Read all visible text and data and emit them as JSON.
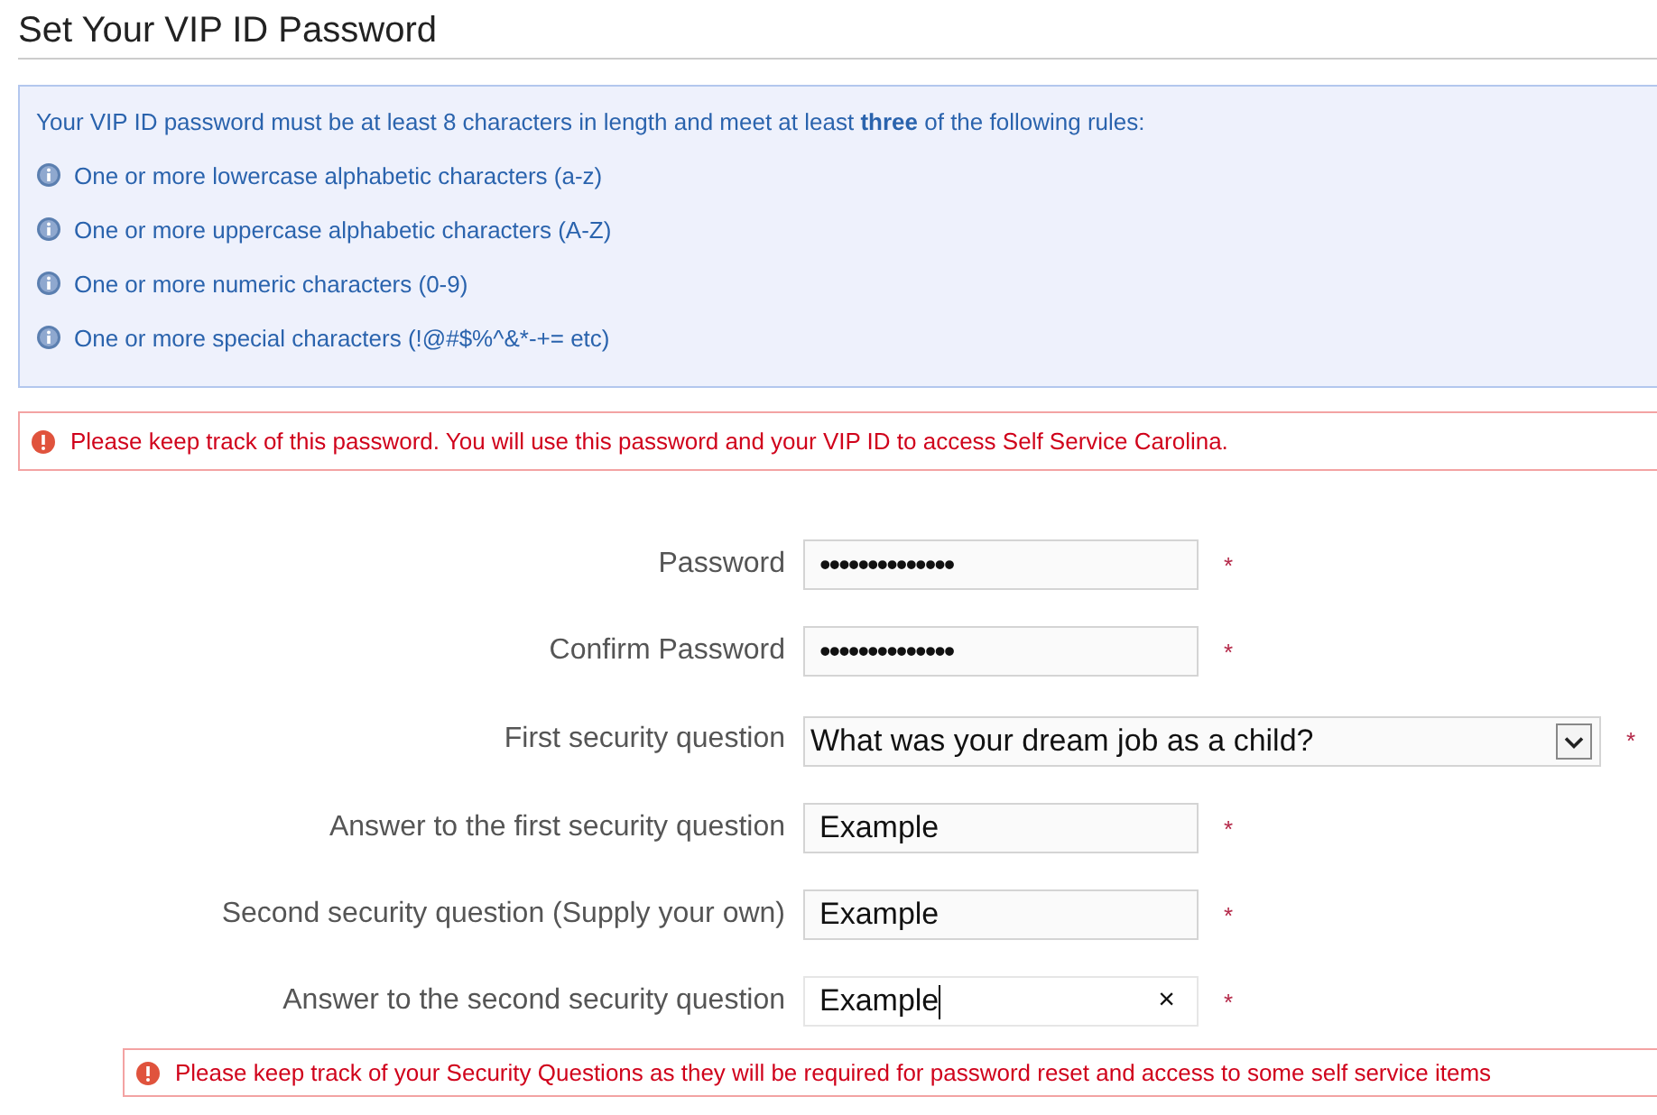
{
  "title": "Set Your VIP ID Password",
  "rules_box": {
    "intro": "Your VIP ID password must be at least 8 characters in length and meet at least **three** of the following rules:",
    "rules": [
      "One or more lowercase alphabetic characters (a-z)",
      "One or more uppercase alphabetic characters (A-Z)",
      "One or more numeric characters (0-9)",
      "One or more special characters (!@#$%^&*-+= etc)"
    ]
  },
  "password_alert": "Please keep track of this password. You will use this password and your VIP ID to access Self Service Carolina.",
  "fields": [
    {
      "label": "Password",
      "kind": "password",
      "value": "••••••••••••••",
      "required_mark": "*",
      "focused": false
    },
    {
      "label": "Confirm Password",
      "kind": "password",
      "value": "••••••••••••••",
      "required_mark": "*",
      "focused": false
    },
    {
      "label": "First security question",
      "kind": "select",
      "value": "What was your dream job as a child?",
      "required_mark": "*",
      "focused": false
    },
    {
      "label": "Answer to the first security question",
      "kind": "text",
      "value": "Example",
      "required_mark": "*",
      "focused": false
    },
    {
      "label": "Second security question (Supply your own)",
      "kind": "text",
      "value": "Example",
      "required_mark": "*",
      "focused": false
    },
    {
      "label": "Answer to the second security question",
      "kind": "text",
      "value": "Example",
      "required_mark": "*",
      "focused": true,
      "clear_button": "×"
    }
  ],
  "questions_alert": "Please keep track of your Security Questions as they will be required for password reset and access to some self service items"
}
